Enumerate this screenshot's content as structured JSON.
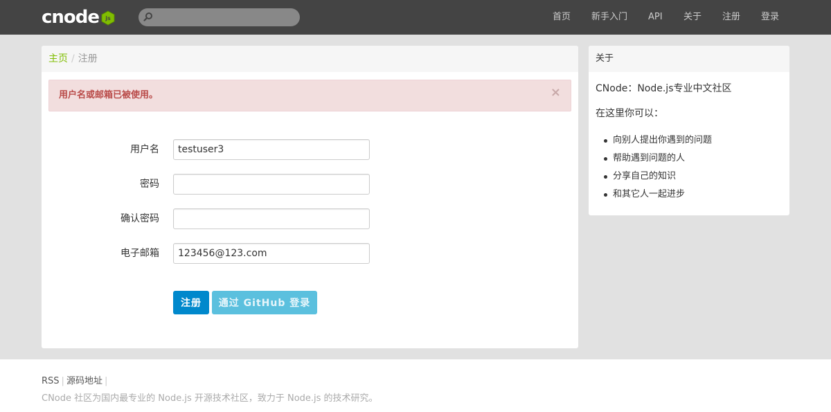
{
  "navbar": {
    "logo_text": "cnode",
    "logo_badge": "js",
    "search": {
      "value": "",
      "placeholder": ""
    },
    "items": [
      {
        "label": "首页"
      },
      {
        "label": "新手入门"
      },
      {
        "label": "API"
      },
      {
        "label": "关于"
      },
      {
        "label": "注册"
      },
      {
        "label": "登录"
      }
    ]
  },
  "breadcrumb": {
    "home": "主页",
    "separator": "/",
    "current": "注册"
  },
  "alert": {
    "message": "用户名或邮箱已被使用。",
    "close": "×"
  },
  "form": {
    "fields": [
      {
        "label": "用户名",
        "value": "testuser3"
      },
      {
        "label": "密码",
        "value": ""
      },
      {
        "label": "确认密码",
        "value": ""
      },
      {
        "label": "电子邮箱",
        "value": "123456@123.com"
      }
    ],
    "submit_label": "注册",
    "github_label": "通过 GitHub 登录"
  },
  "sidebar": {
    "title": "关于",
    "intro": "CNode：Node.js专业中文社区",
    "subtitle": "在这里你可以：",
    "items": [
      "向别人提出你遇到的问题",
      "帮助遇到问题的人",
      "分享自己的知识",
      "和其它人一起进步"
    ]
  },
  "footer": {
    "links": [
      "RSS",
      "源码地址"
    ],
    "separator": "|",
    "description": "CNode 社区为国内最专业的 Node.js 开源技术社区，致力于 Node.js 的技术研究。"
  },
  "colors": {
    "navbar_bg": "#444444",
    "accent_green": "#80bd01",
    "primary_button": "#0088cc",
    "github_button": "#5bc0de",
    "alert_bg": "#f2dede",
    "alert_text": "#b94a48"
  }
}
